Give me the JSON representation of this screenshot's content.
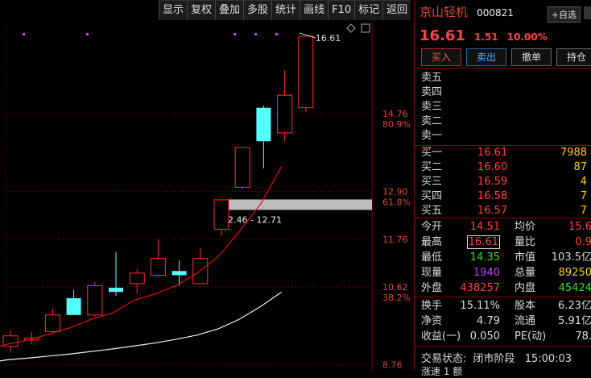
{
  "toolbar": [
    "显示",
    "复权",
    "叠加",
    "多股",
    "统计",
    "画线",
    "F10",
    "标记",
    "返回"
  ],
  "chart": {
    "price_axis": [
      {
        "label": "14.76",
        "pct": "80.9%"
      },
      {
        "label": "12.90",
        "pct": "61.8%"
      },
      {
        "label": "11.76",
        "pct": ""
      },
      {
        "label": "10.62",
        "pct": "38.2%"
      },
      {
        "label": "8.76",
        "pct": ""
      }
    ],
    "high_label": "16.61",
    "band_label": "12.46 - 12.71"
  },
  "chart_data": {
    "type": "candlestick",
    "candles": [
      {
        "o": 9.2,
        "c": 9.45,
        "h": 9.6,
        "l": 9.05,
        "color": "red"
      },
      {
        "o": 9.35,
        "c": 9.4,
        "h": 9.55,
        "l": 9.25,
        "color": "red"
      },
      {
        "o": 9.55,
        "c": 9.95,
        "h": 10.1,
        "l": 9.5,
        "color": "red"
      },
      {
        "o": 10.35,
        "c": 9.95,
        "h": 10.55,
        "l": 9.95,
        "color": "cyan"
      },
      {
        "o": 9.95,
        "c": 10.65,
        "h": 10.75,
        "l": 9.9,
        "color": "red"
      },
      {
        "o": 10.6,
        "c": 10.5,
        "h": 11.45,
        "l": 10.4,
        "color": "cyan"
      },
      {
        "o": 10.7,
        "c": 10.95,
        "h": 11.05,
        "l": 10.45,
        "color": "red"
      },
      {
        "o": 10.9,
        "c": 11.3,
        "h": 11.75,
        "l": 10.85,
        "color": "red"
      },
      {
        "o": 11.0,
        "c": 10.9,
        "h": 11.25,
        "l": 10.65,
        "color": "cyan"
      },
      {
        "o": 10.7,
        "c": 11.3,
        "h": 11.55,
        "l": 10.7,
        "color": "red"
      },
      {
        "o": 12.0,
        "c": 12.7,
        "h": 12.7,
        "l": 11.85,
        "color": "red"
      },
      {
        "o": 13.0,
        "c": 13.95,
        "h": 13.95,
        "l": 12.95,
        "color": "red"
      },
      {
        "o": 14.9,
        "c": 14.1,
        "h": 14.95,
        "l": 13.45,
        "color": "cyan"
      },
      {
        "o": 14.3,
        "c": 15.2,
        "h": 15.8,
        "l": 14.1,
        "color": "red"
      },
      {
        "o": 14.9,
        "c": 16.61,
        "h": 16.61,
        "l": 14.8,
        "color": "red"
      }
    ]
  },
  "stock": {
    "name": "京山轻机",
    "code": "000821",
    "zixuan": "+自选",
    "price": "16.61",
    "chg": "1.51",
    "chgp": "10.00%"
  },
  "buttons": [
    "买入",
    "卖出",
    "撤单",
    "持仓"
  ],
  "asks": [
    "卖五",
    "卖四",
    "卖三",
    "卖二",
    "卖一"
  ],
  "bids": [
    {
      "label": "买一",
      "price": "16.61",
      "vol": "7988"
    },
    {
      "label": "买二",
      "price": "16.60",
      "vol": "87"
    },
    {
      "label": "买三",
      "price": "16.59",
      "vol": "4"
    },
    {
      "label": "买四",
      "price": "16.58",
      "vol": "7"
    },
    {
      "label": "买五",
      "price": "16.57",
      "vol": "7"
    }
  ],
  "stats1": [
    {
      "l": "今开",
      "v": "14.51",
      "vc": "#ff4444",
      "l2": "均价",
      "v2": "15.6",
      "v2c": "#ff4444"
    },
    {
      "l": "最高",
      "v": "16.61",
      "vc": "#ff4444",
      "l2": "量比",
      "v2": "0.9",
      "v2c": "#ff4444"
    },
    {
      "l": "最低",
      "v": "14.35",
      "vc": "#33dd33",
      "l2": "市值",
      "v2": "103.5亿",
      "v2c": "#dddddd"
    },
    {
      "l": "现量",
      "v": "1940",
      "vc": "#cc44ff",
      "l2": "总量",
      "v2": "89250",
      "v2c": "#ffd000"
    },
    {
      "l": "外盘",
      "v": "438257",
      "vc": "#ff4444",
      "l2": "内盘",
      "v2": "45424",
      "v2c": "#33dd33"
    }
  ],
  "stats2": [
    {
      "l": "换手",
      "v": "15.11%",
      "l2": "股本",
      "v2": "6.23亿"
    },
    {
      "l": "净资",
      "v": "4.79",
      "l2": "流通",
      "v2": "5.91亿"
    },
    {
      "l": "收益(一)",
      "v": "0.050",
      "l2": "PE(动)",
      "v2": "78."
    }
  ],
  "status": {
    "label": "交易状态:",
    "state": "闭市阶段",
    "time": "15:00:03"
  },
  "footer2": "涨速 1 额"
}
